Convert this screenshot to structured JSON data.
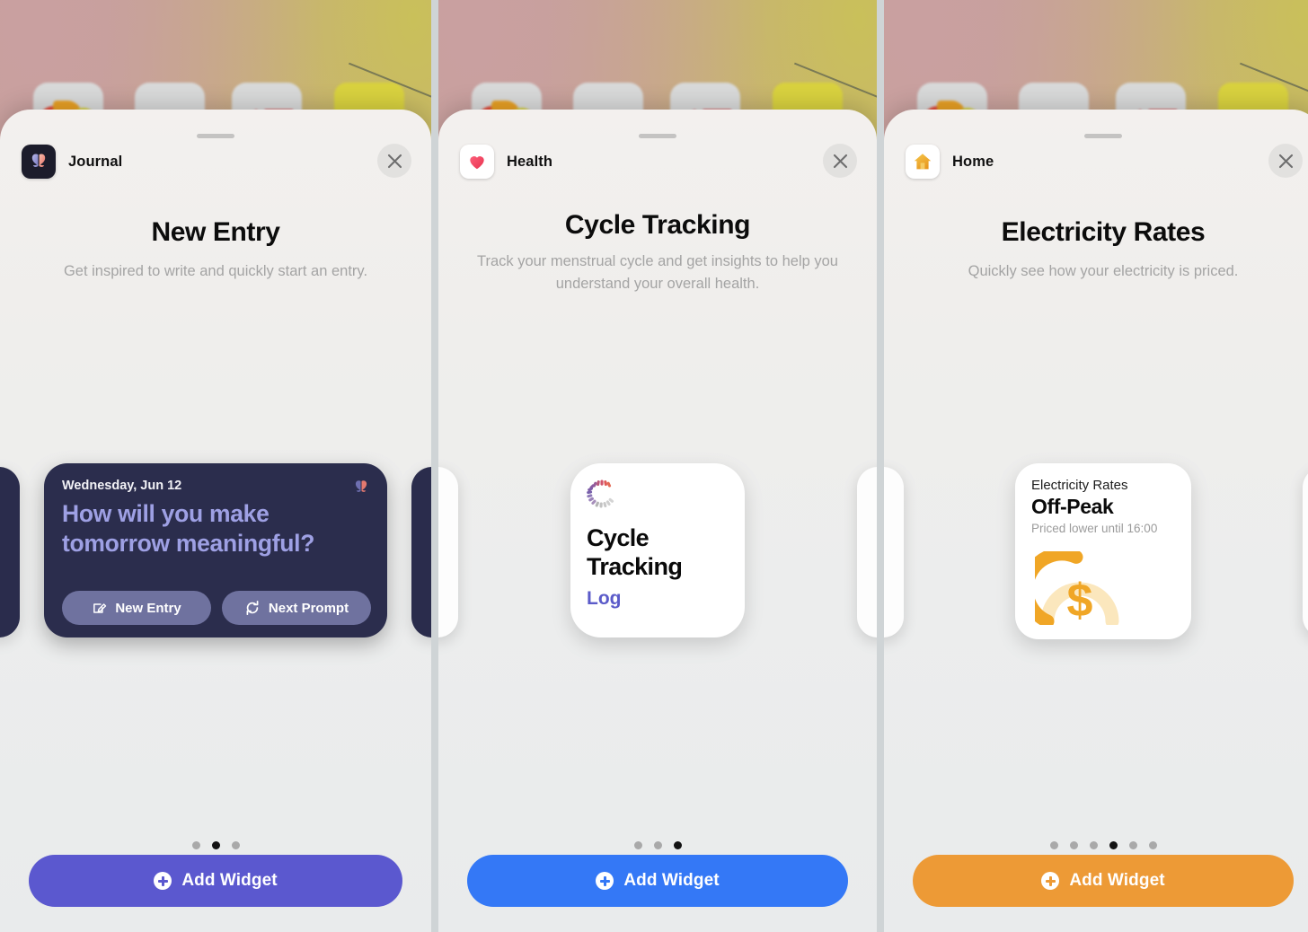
{
  "panels": [
    {
      "app_name": "Journal",
      "app_icon": "journal-app-icon",
      "title": "New Entry",
      "subtitle": "Get inspired to write and quickly start an entry.",
      "close_label": "Close",
      "accent": "#5b58cf",
      "add_button_label": "Add Widget",
      "page_dots": {
        "count": 3,
        "active_index": 1
      },
      "widget": {
        "type": "journal-prompt-widget",
        "date": "Wednesday, Jun 12",
        "prompt": "How will you make tomorrow meaningful?",
        "buttons": [
          {
            "label": "New Entry",
            "icon": "compose-icon"
          },
          {
            "label": "Next Prompt",
            "icon": "refresh-icon"
          }
        ],
        "background": "#2b2d4d",
        "prompt_color": "#9ea0e4"
      }
    },
    {
      "app_name": "Health",
      "app_icon": "health-heart-icon",
      "title": "Cycle Tracking",
      "subtitle": "Track your menstrual cycle and get insights to help you understand your overall health.",
      "close_label": "Close",
      "accent": "#3478f6",
      "add_button_label": "Add Widget",
      "page_dots": {
        "count": 3,
        "active_index": 2
      },
      "widget": {
        "type": "cycle-tracking-widget",
        "icon": "cycle-ring-icon",
        "title": "Cycle Tracking",
        "action_label": "Log",
        "action_color": "#5b5bc9",
        "background": "#ffffff"
      }
    },
    {
      "app_name": "Home",
      "app_icon": "home-house-icon",
      "title": "Electricity Rates",
      "subtitle": "Quickly see how your electricity is priced.",
      "close_label": "Close",
      "accent": "#ed9a36",
      "add_button_label": "Add Widget",
      "page_dots": {
        "count": 6,
        "active_index": 3
      },
      "widget": {
        "type": "electricity-rates-widget",
        "label": "Electricity Rates",
        "state": "Off-Peak",
        "detail": "Priced lower until 16:00",
        "icon": "dollar-gauge-icon",
        "gauge_fill_color": "#f0a626",
        "gauge_track_color": "#fbe7bd",
        "background": "#ffffff"
      }
    }
  ]
}
